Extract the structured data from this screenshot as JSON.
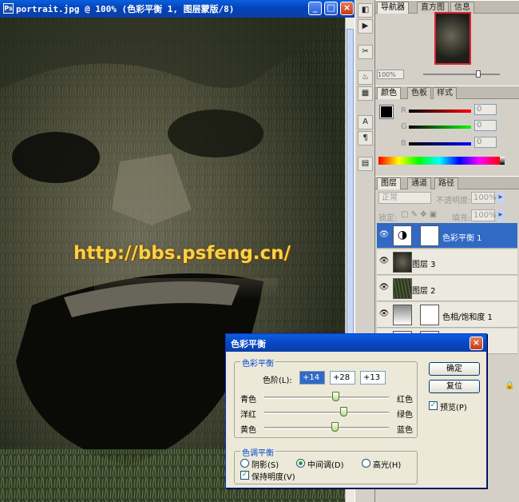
{
  "document": {
    "title": "portrait.jpg @ 100% (色彩平衡 1, 图层蒙版/8)",
    "watermark": "http://bbs.psfeng.cn/"
  },
  "panels": {
    "navigator_tabs": [
      "导航器",
      "直方图",
      "信息"
    ],
    "navigator_zoom": "100%",
    "color_tabs": [
      "颜色",
      "色板",
      "样式"
    ],
    "color_channels": [
      {
        "label": "R",
        "value": "0"
      },
      {
        "label": "G",
        "value": "0"
      },
      {
        "label": "B",
        "value": "0"
      }
    ],
    "layers_tabs": [
      "图层",
      "通道",
      "路径"
    ],
    "blend_mode": "正常",
    "opacity_label": "不透明度:",
    "opacity_value": "100%",
    "lock_label": "锁定:",
    "fill_label": "填充:",
    "fill_value": "100%",
    "layers": [
      {
        "name": "色彩平衡 1",
        "selected": true
      },
      {
        "name": "图层 3",
        "selected": false
      },
      {
        "name": "图层 2",
        "selected": false
      },
      {
        "name": "色相/饱和度 1",
        "selected": false
      },
      {
        "name": "曲线",
        "selected": false
      }
    ]
  },
  "dialog": {
    "title": "色彩平衡",
    "color_balance_group": "色彩平衡",
    "levels_label": "色阶(L):",
    "levels": [
      "+14",
      "+28",
      "+13"
    ],
    "sliders": [
      {
        "left": "青色",
        "right": "红色",
        "value": 14
      },
      {
        "left": "洋红",
        "right": "绿色",
        "value": 28
      },
      {
        "left": "黄色",
        "right": "蓝色",
        "value": 13
      }
    ],
    "tone_group": "色调平衡",
    "tones": [
      {
        "label": "阴影(S)",
        "checked": false
      },
      {
        "label": "中间调(D)",
        "checked": true
      },
      {
        "label": "高光(H)",
        "checked": false
      }
    ],
    "preserve_luminosity": "保持明度(V)",
    "ok_label": "确定",
    "reset_label": "复位",
    "preview_label": "预览(P)"
  }
}
